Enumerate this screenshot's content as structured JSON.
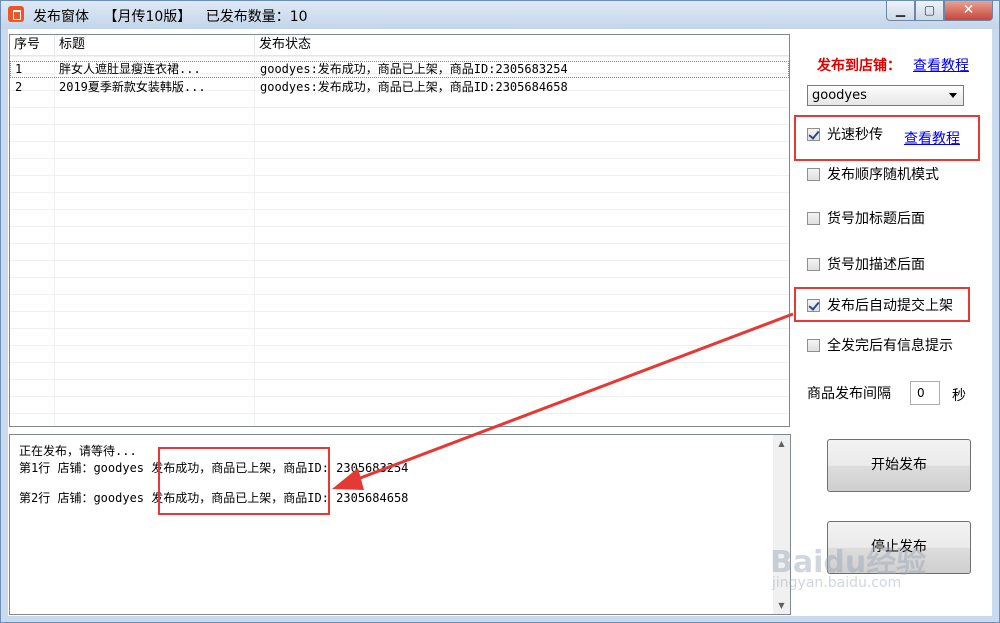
{
  "window": {
    "title": "发布窗体",
    "edition": "【月传10版】",
    "published_count_label": "已发布数量：10"
  },
  "list": {
    "columns": [
      "序号",
      "标题",
      "发布状态"
    ],
    "rows": [
      {
        "no": "1",
        "title": "胖女人遮肚显瘦连衣裙...",
        "status": "goodyes:发布成功，商品已上架，商品ID:2305683254"
      },
      {
        "no": "2",
        "title": "2019夏季新款女装韩版...",
        "status": "goodyes:发布成功，商品已上架，商品ID:2305684658"
      }
    ]
  },
  "log": {
    "lines": [
      "正在发布，请等待...",
      "第1行 店铺：goodyes 发布成功，商品已上架，商品ID: 2305683254",
      "第2行 店铺：goodyes 发布成功，商品已上架，商品ID: 2305684658"
    ]
  },
  "panel": {
    "publish_to_label": "发布到店铺：",
    "tutorial_link": "查看教程",
    "store_selected": "goodyes",
    "options": [
      {
        "label": "光速秒传",
        "checked": true
      },
      {
        "label": "发布顺序随机模式",
        "checked": false
      },
      {
        "label": "货号加标题后面",
        "checked": false
      },
      {
        "label": "货号加描述后面",
        "checked": false
      },
      {
        "label": "发布后自动提交上架",
        "checked": true
      },
      {
        "label": "全发完后有信息提示",
        "checked": false
      }
    ],
    "interval_label": "商品发布间隔",
    "interval_value": "0",
    "interval_unit": "秒",
    "start_button": "开始发布",
    "stop_button": "停止发布"
  },
  "watermark": {
    "text": "Baidu经验",
    "sub": "jingyan.baidu.com"
  },
  "colors": {
    "accent_red": "#e53935",
    "link_blue": "#0000ee",
    "label_red": "#e00000"
  }
}
